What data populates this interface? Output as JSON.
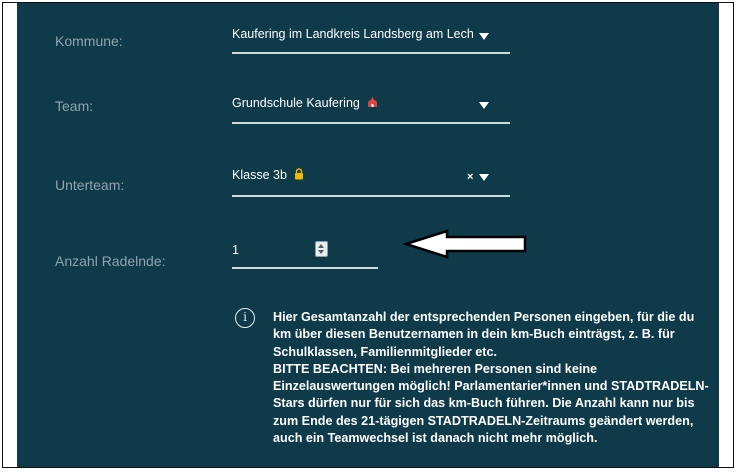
{
  "form": {
    "kommune": {
      "label": "Kommune:",
      "value": "Kaufering im Landkreis Landsberg am Lech"
    },
    "team": {
      "label": "Team:",
      "value": "Grundschule Kaufering",
      "value_icon": "school-building-icon"
    },
    "unterteam": {
      "label": "Unterteam:",
      "value": "Klasse 3b",
      "value_icon": "lock-icon",
      "clear": "×"
    },
    "anzahl": {
      "label": "Anzahl Radelnde:",
      "value": "1"
    }
  },
  "info": {
    "icon": "info-icon",
    "glyph": "i",
    "paragraph1": "Hier Gesamtanzahl der entsprechenden Personen eingeben, für die du km über diesen Benutzernamen in dein km-Buch einträgst, z. B. für Schulklassen, Familienmitglieder etc.",
    "paragraph2": "BITTE BEACHTEN: Bei mehreren Personen sind keine Einzelauswertungen möglich! Parlamentarier*innen und STADTRADELN-Stars dürfen nur für sich das km-Buch führen. Die Anzahl kann nur bis zum Ende des 21-tägigen STADTRADELN-Zeitraums geändert werden, auch ein Teamwechsel ist danach nicht mehr möglich."
  },
  "annotation": {
    "icon": "arrow-left-icon"
  },
  "colors": {
    "panel": "#0e3a4a",
    "label": "#8fa4ad",
    "text": "#ffffff",
    "team_icon": "#e0433b",
    "lock_icon": "#f2b705"
  }
}
